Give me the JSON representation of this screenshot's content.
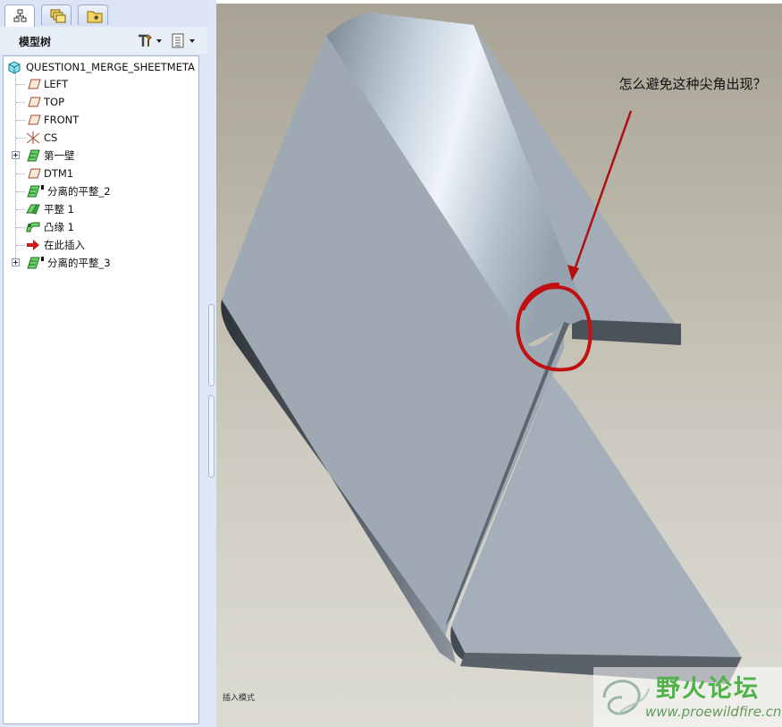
{
  "panel": {
    "tabs": [
      {
        "icon": "model-tree-icon",
        "active": true
      },
      {
        "icon": "layers-icon",
        "active": false
      },
      {
        "icon": "folder-star-icon",
        "active": false
      }
    ],
    "title": "模型树",
    "settings_icon": "tree-settings-icon",
    "columns_icon": "tree-columns-icon"
  },
  "tree": {
    "root": "QUESTION1_MERGE_SHEETMETA",
    "items": [
      {
        "label": "LEFT",
        "icon": "datum-plane-icon",
        "expandable": false
      },
      {
        "label": "TOP",
        "icon": "datum-plane-icon",
        "expandable": false
      },
      {
        "label": "FRONT",
        "icon": "datum-plane-icon",
        "expandable": false
      },
      {
        "label": "CS",
        "icon": "coordinate-system-icon",
        "expandable": false
      },
      {
        "label": "第一壁",
        "icon": "sheetmetal-wall-icon",
        "expandable": true
      },
      {
        "label": "DTM1",
        "icon": "datum-plane-icon",
        "expandable": false
      },
      {
        "label": "分离的平整_2",
        "icon": "sheetmetal-wall-icon",
        "expandable": false
      },
      {
        "label": "平整 1",
        "icon": "flat-wall-icon",
        "expandable": false
      },
      {
        "label": "凸缘 1",
        "icon": "flange-wall-icon",
        "expandable": false
      },
      {
        "label": "在此插入",
        "icon": "insert-here-arrow-icon",
        "expandable": false
      },
      {
        "label": "分离的平整_3",
        "icon": "sheetmetal-wall-icon",
        "expandable": true
      }
    ]
  },
  "viewport": {
    "annotation": "怎么避免这种尖角出现？",
    "status": "插入模式",
    "annotation_color": "#b01010"
  },
  "watermark": {
    "title": "野火论坛",
    "url": "www.proewildfire.cn"
  },
  "colors": {
    "panel_bg": "#dfe8f6",
    "model_face": "#a3adb7",
    "model_edge": "#4a5058"
  }
}
